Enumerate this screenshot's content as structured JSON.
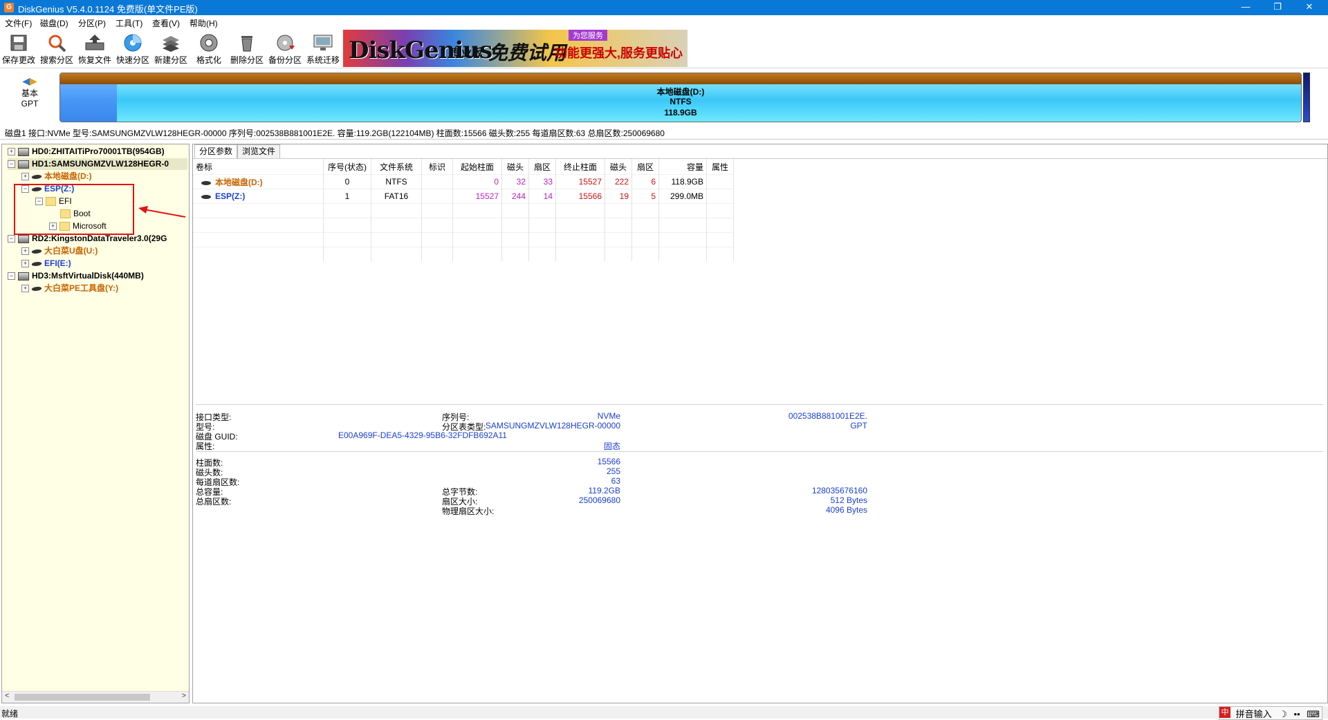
{
  "window": {
    "title": "DiskGenius V5.4.0.1124 免费版(单文件PE版)",
    "minimize": "—",
    "restore": "❐",
    "close": "✕"
  },
  "menu": [
    "文件(F)",
    "磁盘(D)",
    "分区(P)",
    "工具(T)",
    "查看(V)",
    "帮助(H)"
  ],
  "toolbar": [
    {
      "label": "保存更改",
      "icon": "save-icon"
    },
    {
      "label": "搜索分区",
      "icon": "search-icon"
    },
    {
      "label": "恢复文件",
      "icon": "recover-icon"
    },
    {
      "label": "快速分区",
      "icon": "quick-partition-icon"
    },
    {
      "label": "新建分区",
      "icon": "new-partition-icon"
    },
    {
      "label": "格式化",
      "icon": "format-icon"
    },
    {
      "label": "删除分区",
      "icon": "delete-icon"
    },
    {
      "label": "备份分区",
      "icon": "backup-icon"
    },
    {
      "label": "系统迁移",
      "icon": "migrate-icon"
    }
  ],
  "banner": {
    "brand": "DiskGenius",
    "edition": "专业版",
    "trial": "免费试用",
    "tagline": "功能更强大,服务更贴心",
    "top": "为您服务"
  },
  "disk_nav": {
    "line1": "基本",
    "line2": "GPT"
  },
  "partition_bar": {
    "name": "本地磁盘(D:)",
    "fs": "NTFS",
    "size": "118.9GB"
  },
  "disk_info": "磁盘1 接口:NVMe  型号:SAMSUNGMZVLW128HEGR-00000  序列号:002538B881001E2E.  容量:119.2GB(122104MB)  柱面数:15566  磁头数:255  每道扇区数:63  总扇区数:250069680",
  "tree": {
    "hd0": "HD0:ZHITAITiPro70001TB(954GB)",
    "hd1": "HD1:SAMSUNGMZVLW128HEGR-0",
    "local_d": "本地磁盘(D:)",
    "esp": "ESP(Z:)",
    "efi": "EFI",
    "boot": "Boot",
    "microsoft": "Microsoft",
    "rd2": "RD2:KingstonDataTraveler3.0(29G",
    "dabaicai_u": "大白菜U盘(U:)",
    "efi_e": "EFI(E:)",
    "hd3": "HD3:MsftVirtualDisk(440MB)",
    "dabaicai_pe": "大白菜PE工具盘(Y:)"
  },
  "tabs": [
    "分区参数",
    "浏览文件"
  ],
  "table": {
    "headers": [
      "卷标",
      "序号(状态)",
      "文件系统",
      "标识",
      "起始柱面",
      "磁头",
      "扇区",
      "终止柱面",
      "磁头",
      "扇区",
      "容量",
      "属性"
    ],
    "rows": [
      [
        "本地磁盘(D:)",
        "0",
        "NTFS",
        "",
        "0",
        "32",
        "33",
        "15527",
        "222",
        "6",
        "118.9GB",
        ""
      ],
      [
        "ESP(Z:)",
        "1",
        "FAT16",
        "",
        "15527",
        "244",
        "14",
        "15566",
        "19",
        "5",
        "299.0MB",
        ""
      ]
    ]
  },
  "details": {
    "iface_label": "接口类型:",
    "iface_val": "NVMe",
    "sn_label": "序列号:",
    "sn_val": "002538B881001E2E.",
    "model_label": "型号:",
    "model_val": "SAMSUNGMZVLW128HEGR-00000",
    "pt_label": "分区表类型:",
    "pt_val": "GPT",
    "guid_label": "磁盘 GUID:",
    "guid_val": "E00A969F-DEA5-4329-95B6-32FDFB692A11",
    "attr_label": "属性:",
    "attr_val": "固态",
    "cyl_label": "柱面数:",
    "cyl_val": "15566",
    "heads_label": "磁头数:",
    "heads_val": "255",
    "spt_label": "每道扇区数:",
    "spt_val": "63",
    "cap_label": "总容量:",
    "cap_val": "119.2GB",
    "bytes_label": "总字节数:",
    "bytes_val": "128035676160",
    "sectors_label": "总扇区数:",
    "sectors_val": "250069680",
    "ssize_label": "扇区大小:",
    "ssize_val": "512 Bytes",
    "pssize_label": "物理扇区大小:",
    "pssize_val": "4096 Bytes"
  },
  "status": "就绪",
  "ime": {
    "badge": "中",
    "label": "拼音输入",
    "moon": "☽",
    "dots": "••",
    "kbd": "⌨"
  }
}
